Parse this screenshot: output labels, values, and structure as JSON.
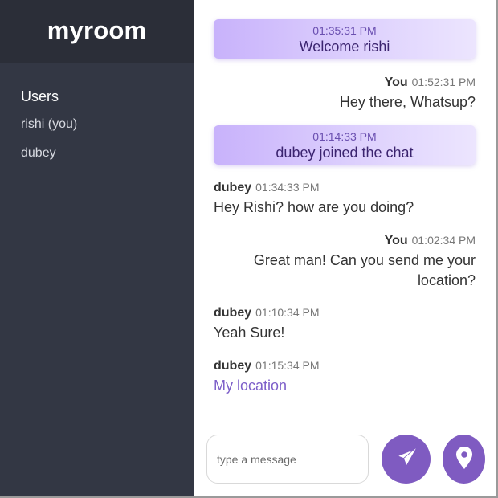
{
  "room": {
    "name": "myroom"
  },
  "sidebar": {
    "users_title": "Users",
    "users": [
      "rishi (you)",
      "dubey"
    ]
  },
  "messages": [
    {
      "kind": "system",
      "time": "01:35:31 PM",
      "text": "Welcome rishi"
    },
    {
      "kind": "mine",
      "user": "You",
      "time": "01:52:31 PM",
      "text": "Hey there, Whatsup?"
    },
    {
      "kind": "system",
      "time": "01:14:33 PM",
      "text": "dubey joined the chat"
    },
    {
      "kind": "other",
      "user": "dubey",
      "time": "01:34:33 PM",
      "text": "Hey Rishi? how are you doing?"
    },
    {
      "kind": "mine",
      "user": "You",
      "time": "01:02:34 PM",
      "text_lines": [
        "Great man! Can you send me your",
        "location?"
      ]
    },
    {
      "kind": "other",
      "user": "dubey",
      "time": "01:10:34 PM",
      "text": "Yeah Sure!"
    },
    {
      "kind": "other",
      "user": "dubey",
      "time": "01:15:34 PM",
      "link_text": "My location"
    }
  ],
  "composer": {
    "placeholder": "type a message",
    "send_icon": "paper-plane-icon",
    "location_icon": "location-pin-icon"
  },
  "colors": {
    "sidebar_bg": "#333744",
    "header_bg": "#2b2e38",
    "accent": "#7f5bc1",
    "link": "#7d5fc9"
  }
}
